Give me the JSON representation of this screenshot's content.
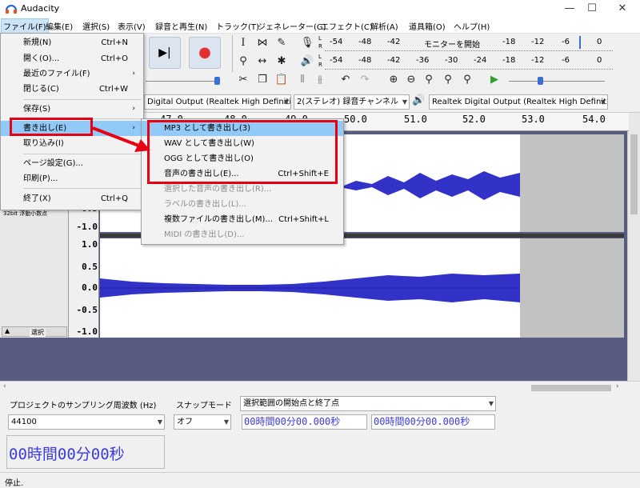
{
  "window": {
    "title": "Audacity",
    "minimize": "—",
    "maximize": "☐",
    "close": "✕"
  },
  "menubar": {
    "items": [
      "ファイル(F)",
      "編集(E)",
      "選択(S)",
      "表示(V)",
      "録音と再生(N)",
      "トラック(T)",
      "ジェネレーター(G)",
      "エフェクト(C)",
      "解析(A)",
      "道具箱(O)",
      "ヘルプ(H)"
    ]
  },
  "meters": {
    "rec_scale": [
      "-54",
      "-48",
      "-42",
      "モニターを開始",
      "-18",
      "-12",
      "-6",
      "0"
    ],
    "play_scale": [
      "-54",
      "-48",
      "-42",
      "-36",
      "-30",
      "-24",
      "-18",
      "-12",
      "-6",
      "0"
    ],
    "left_channel": "L",
    "right_channel": "R"
  },
  "devices": {
    "playback_device": "Digital Output (Realtek High Definiti",
    "rec_channels": "2(ステレオ) 録音チャンネル",
    "output_device": "Realtek Digital Output (Realtek High Definiti"
  },
  "ruler": {
    "ticks": [
      "47.0",
      "48.0",
      "49.0",
      "50.0",
      "51.0",
      "52.0",
      "53.0",
      "54.0"
    ]
  },
  "track": {
    "format_label": "32bit 浮動小数点",
    "select_button": "選択",
    "scale_top": [
      "0.5",
      "-1.0"
    ],
    "scale_bottom": [
      "1.0",
      "0.5",
      "0.0",
      "-0.5",
      "-1.0"
    ]
  },
  "file_menu": {
    "items": [
      {
        "label": "新規(N)",
        "shortcut": "Ctrl+N"
      },
      {
        "label": "開く(O)...",
        "shortcut": "Ctrl+O"
      },
      {
        "label": "最近のファイル(F)",
        "shortcut": ""
      },
      {
        "label": "閉じる(C)",
        "shortcut": "Ctrl+W"
      },
      {
        "label": "保存(S)",
        "shortcut": ""
      },
      {
        "label": "書き出し(E)",
        "shortcut": ""
      },
      {
        "label": "取り込み(I)",
        "shortcut": ""
      },
      {
        "label": "ページ設定(G)...",
        "shortcut": ""
      },
      {
        "label": "印刷(P)...",
        "shortcut": ""
      },
      {
        "label": "終了(X)",
        "shortcut": "Ctrl+Q"
      }
    ]
  },
  "export_submenu": {
    "items": [
      {
        "label": "MP3 として書き出し(3)",
        "shortcut": ""
      },
      {
        "label": "WAV として書き出し(W)",
        "shortcut": ""
      },
      {
        "label": "OGG として書き出し(O)",
        "shortcut": ""
      },
      {
        "label": "音声の書き出し(E)...",
        "shortcut": "Ctrl+Shift+E"
      },
      {
        "label": "選択した音声の書き出し(R)...",
        "shortcut": ""
      },
      {
        "label": "ラベルの書き出し(L)...",
        "shortcut": ""
      },
      {
        "label": "複数ファイルの書き出し(M)...",
        "shortcut": "Ctrl+Shift+L"
      },
      {
        "label": "MIDI の書き出し(D)...",
        "shortcut": ""
      }
    ]
  },
  "selection_bar": {
    "rate_label": "プロジェクトのサンプリング周波数 (Hz)",
    "rate_value": "44100",
    "snap_label": "スナップモード",
    "snap_value": "オフ",
    "range_label": "選択範囲の開始点と終了点",
    "start_time": "00時間00分00.000秒",
    "end_time": "00時間00分00.000秒"
  },
  "audio_position": "00時間00分00秒",
  "status": "停止.",
  "colors": {
    "waveform": "#3232c8",
    "annotation_red": "#e60012",
    "highlight": "#91c9f7"
  }
}
